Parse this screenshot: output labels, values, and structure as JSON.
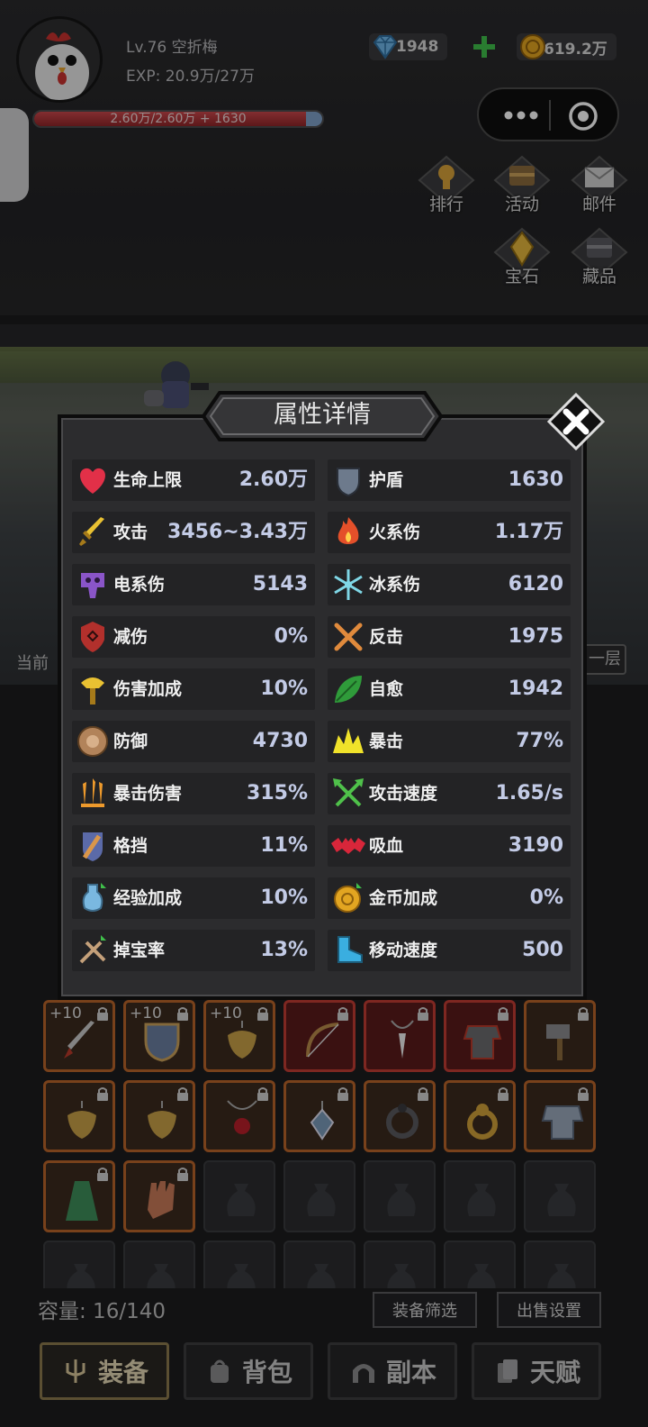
{
  "player": {
    "level_name": "Lv.76 空折梅",
    "exp": "EXP: 20.9万/27万",
    "hp_text": "2.60万/2.60万 + 1630",
    "hp_fraction": 0.95
  },
  "currency": {
    "gems": "1948",
    "gold": "619.2万"
  },
  "menu": {
    "rank": "排行",
    "activity": "活动",
    "mail": "邮件",
    "gem": "宝石",
    "collection": "藏品"
  },
  "peek": {
    "left": "当前",
    "right": "一层"
  },
  "modal": {
    "title": "属性详情",
    "stats": [
      {
        "name": "生命上限",
        "value": "2.60万",
        "icon": "heart-icon"
      },
      {
        "name": "护盾",
        "value": "1630",
        "icon": "shield-icon"
      },
      {
        "name": "攻击",
        "value": "3456~3.43万",
        "icon": "sword-icon"
      },
      {
        "name": "火系伤",
        "value": "1.17万",
        "icon": "fire-icon"
      },
      {
        "name": "电系伤",
        "value": "5143",
        "icon": "lightning-skull-icon"
      },
      {
        "name": "冰系伤",
        "value": "6120",
        "icon": "snowflake-icon"
      },
      {
        "name": "减伤",
        "value": "0%",
        "icon": "damage-reduction-icon"
      },
      {
        "name": "反击",
        "value": "1975",
        "icon": "crossed-swords-icon"
      },
      {
        "name": "伤害加成",
        "value": "10%",
        "icon": "hammer-icon"
      },
      {
        "name": "自愈",
        "value": "1942",
        "icon": "leaf-icon"
      },
      {
        "name": "防御",
        "value": "4730",
        "icon": "round-shield-icon"
      },
      {
        "name": "暴击",
        "value": "77%",
        "icon": "crit-burst-icon"
      },
      {
        "name": "暴击伤害",
        "value": "315%",
        "icon": "triple-blade-icon"
      },
      {
        "name": "攻击速度",
        "value": "1.65/s",
        "icon": "crossed-arrows-icon"
      },
      {
        "name": "格挡",
        "value": "11%",
        "icon": "block-shield-icon"
      },
      {
        "name": "吸血",
        "value": "3190",
        "icon": "bat-icon"
      },
      {
        "name": "经验加成",
        "value": "10%",
        "icon": "exp-potion-icon"
      },
      {
        "name": "金币加成",
        "value": "0%",
        "icon": "gold-coin-icon"
      },
      {
        "name": "掉宝率",
        "value": "13%",
        "icon": "loot-icon"
      },
      {
        "name": "移动速度",
        "value": "500",
        "icon": "boot-icon"
      }
    ]
  },
  "inventory": {
    "capacity": "容量: 16/140",
    "filter_label": "装备筛选",
    "sell_label": "出售设置",
    "slots": [
      {
        "plus": "+10",
        "rarity": "orange",
        "item": "sword-item-icon"
      },
      {
        "plus": "+10",
        "rarity": "orange",
        "item": "shield-item-icon"
      },
      {
        "plus": "+10",
        "rarity": "orange",
        "item": "griffin-amulet-icon"
      },
      {
        "plus": "",
        "rarity": "red",
        "item": "bow-item-icon"
      },
      {
        "plus": "",
        "rarity": "red",
        "item": "fang-necklace-icon"
      },
      {
        "plus": "",
        "rarity": "red",
        "item": "armor-item-icon"
      },
      {
        "plus": "",
        "rarity": "orange",
        "item": "warhammer-item-icon"
      },
      {
        "plus": "",
        "rarity": "orange",
        "item": "griffin-amulet-icon"
      },
      {
        "plus": "",
        "rarity": "orange",
        "item": "griffin-amulet-icon"
      },
      {
        "plus": "",
        "rarity": "orange",
        "item": "ruby-necklace-icon"
      },
      {
        "plus": "",
        "rarity": "orange",
        "item": "crystal-pendant-icon"
      },
      {
        "plus": "",
        "rarity": "orange",
        "item": "dark-ring-icon"
      },
      {
        "plus": "",
        "rarity": "orange",
        "item": "gold-ring-icon"
      },
      {
        "plus": "",
        "rarity": "orange",
        "item": "plate-armor-icon"
      },
      {
        "plus": "",
        "rarity": "orange",
        "item": "green-cloak-icon"
      },
      {
        "plus": "",
        "rarity": "orange",
        "item": "glove-item-icon"
      }
    ]
  },
  "nav": {
    "equip": "装备",
    "bag": "背包",
    "dungeon": "副本",
    "talent": "天赋"
  },
  "colors": {
    "stat_value": "#c3cbe6",
    "slot_orange": "#b8642a",
    "slot_red": "#c23c34"
  }
}
